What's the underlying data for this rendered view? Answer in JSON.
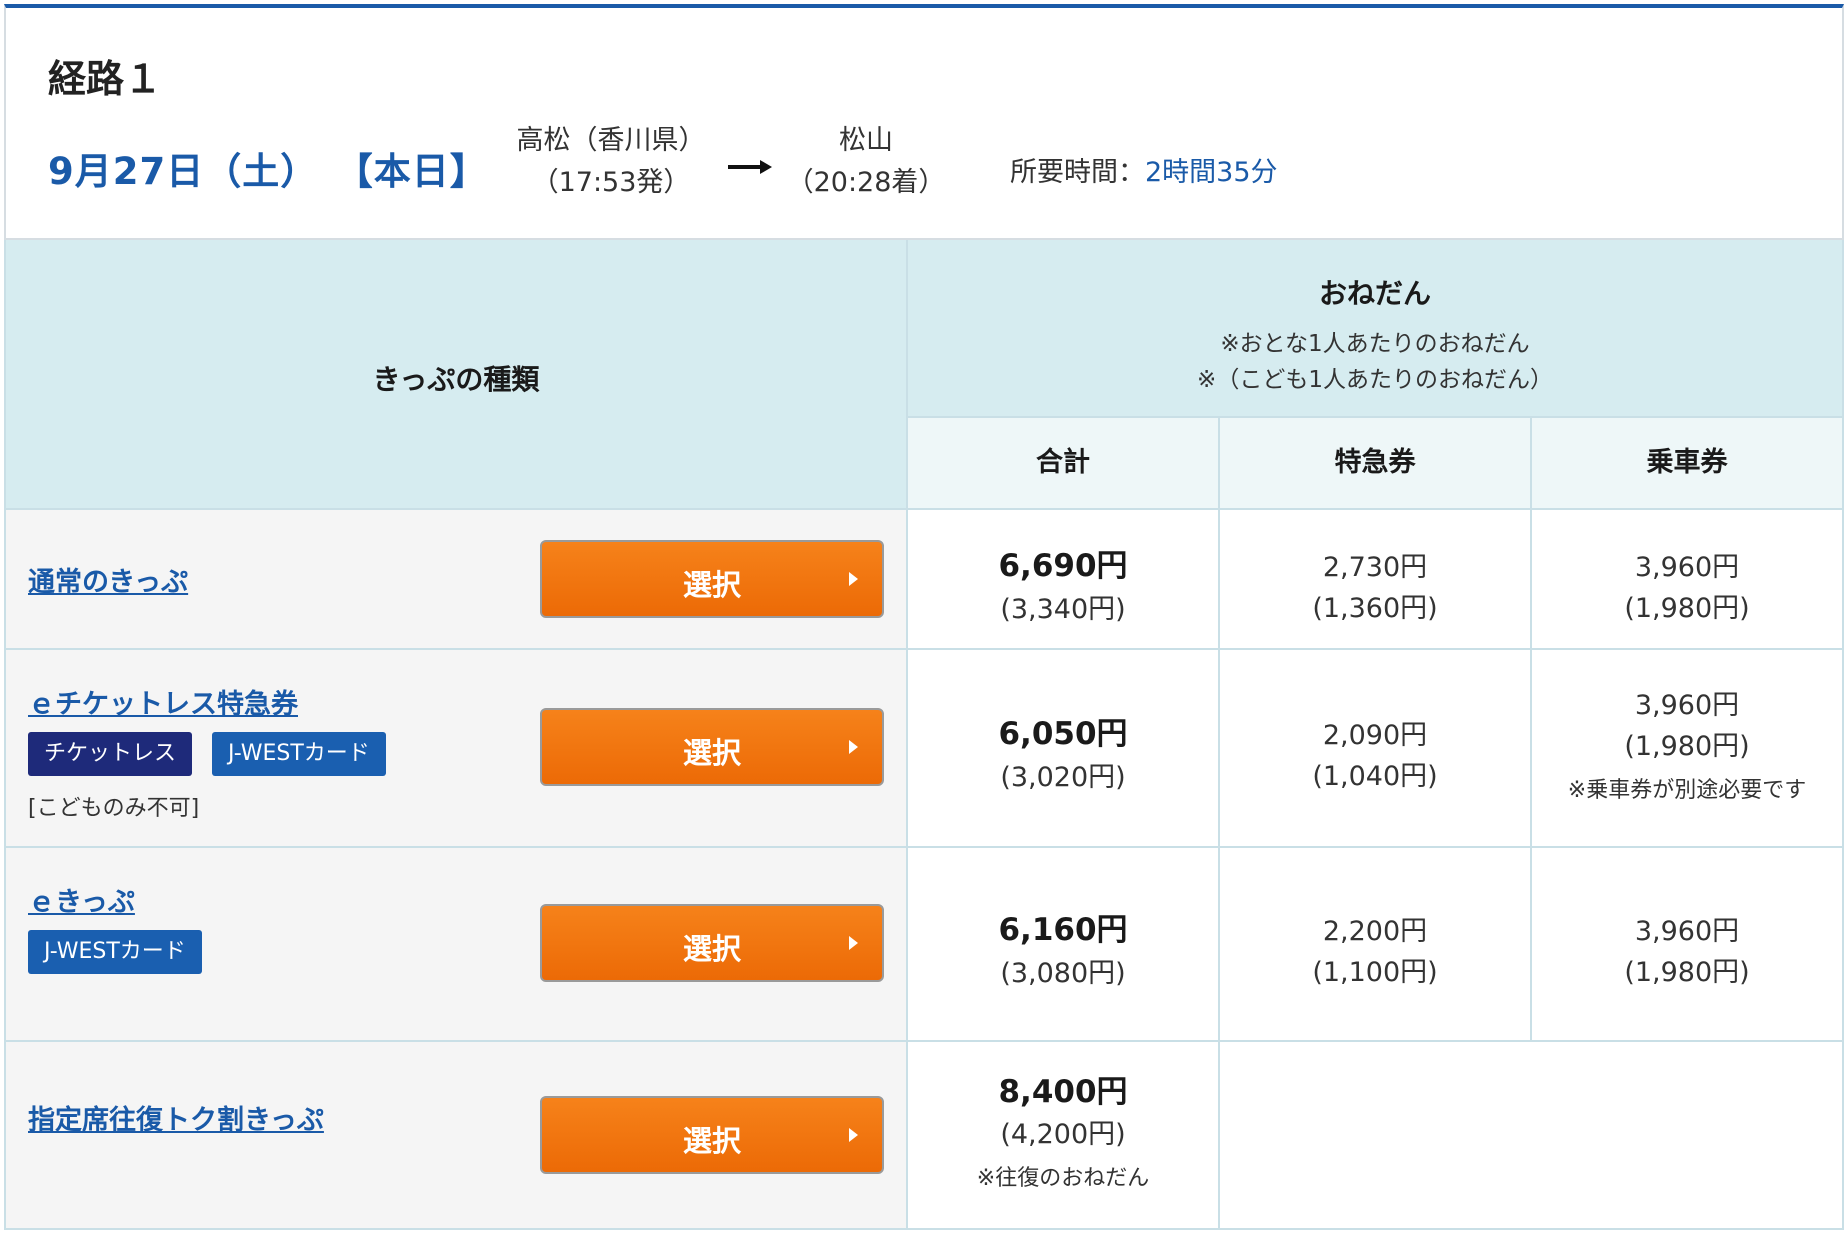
{
  "route": {
    "title": "経路１",
    "date": "9月27日（土）",
    "today": "【本日】",
    "from_station": "高松（香川県）",
    "from_time": "（17:53発）",
    "to_station": "松山",
    "to_time": "（20:28着）",
    "duration_label": "所要時間：",
    "duration_value": "2時間35分"
  },
  "table": {
    "type_header": "きっぷの種類",
    "price_header": "おねだん",
    "price_note_adult": "※おとな1人あたりのおねだん",
    "price_note_child": "※（こども1人あたりのおねだん）",
    "col_total": "合計",
    "col_express": "特急券",
    "col_fare": "乗車券"
  },
  "select_label": "選択",
  "tickets": [
    {
      "name": "通常のきっぷ",
      "total": "6,690円",
      "total_child": "(3,340円)",
      "express": "2,730円",
      "express_child": "(1,360円)",
      "fare": "3,960円",
      "fare_child": "(1,980円)"
    },
    {
      "name": "ｅチケットレス特急券",
      "badge1": "チケットレス",
      "badge2": "J-WESTカード",
      "restriction": "[こどものみ不可]",
      "total": "6,050円",
      "total_child": "(3,020円)",
      "express": "2,090円",
      "express_child": "(1,040円)",
      "fare": "3,960円",
      "fare_child": "(1,980円)",
      "fare_note": "※乗車券が別途必要です"
    },
    {
      "name": "ｅきっぷ",
      "badge1": "J-WESTカード",
      "total": "6,160円",
      "total_child": "(3,080円)",
      "express": "2,200円",
      "express_child": "(1,100円)",
      "fare": "3,960円",
      "fare_child": "(1,980円)"
    },
    {
      "name": "指定席往復トク割きっぷ",
      "total": "8,400円",
      "total_child": "(4,200円)",
      "total_note": "※往復のおねだん"
    }
  ],
  "colors": {
    "accent_blue": "#1a5aa8",
    "header_bg": "#d6ecf0",
    "button_orange": "#f07510",
    "badge_navy": "#1e2a7a",
    "badge_blue": "#1a5fb0"
  },
  "icons": [
    "right-arrow-icon",
    "play-triangle-icon"
  ]
}
